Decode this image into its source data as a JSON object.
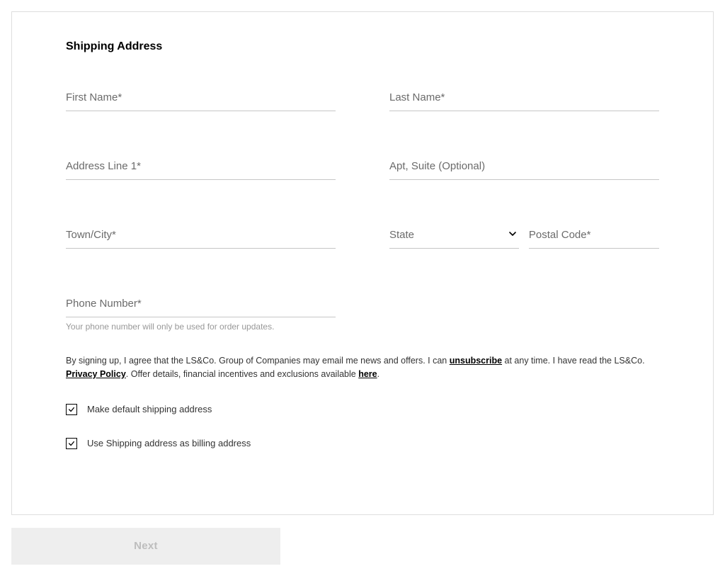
{
  "section_title": "Shipping Address",
  "fields": {
    "first_name": {
      "placeholder": "First Name*",
      "value": ""
    },
    "last_name": {
      "placeholder": "Last Name*",
      "value": ""
    },
    "address_line_1": {
      "placeholder": "Address Line 1*",
      "value": ""
    },
    "apt_suite": {
      "placeholder": "Apt, Suite (Optional)",
      "value": ""
    },
    "town_city": {
      "placeholder": "Town/City*",
      "value": ""
    },
    "state": {
      "label": "State"
    },
    "postal_code": {
      "placeholder": "Postal Code*",
      "value": ""
    },
    "phone_number": {
      "placeholder": "Phone Number*",
      "value": ""
    }
  },
  "phone_helper": "Your phone number will only be used for order updates.",
  "legal": {
    "part1": "By signing up, I agree that the LS&Co. Group of Companies may email me news and offers. I can ",
    "unsubscribe_label": "unsubscribe",
    "part2": " at any time. I have read the LS&Co. ",
    "privacy_label": "Privacy Policy",
    "part3": ". Offer details, financial incentives and exclusions available ",
    "here_label": "here",
    "part4": "."
  },
  "checkboxes": {
    "default_shipping": {
      "label": "Make default shipping address",
      "checked": true
    },
    "use_as_billing": {
      "label": "Use Shipping address as billing address",
      "checked": true
    }
  },
  "next_button_label": "Next"
}
